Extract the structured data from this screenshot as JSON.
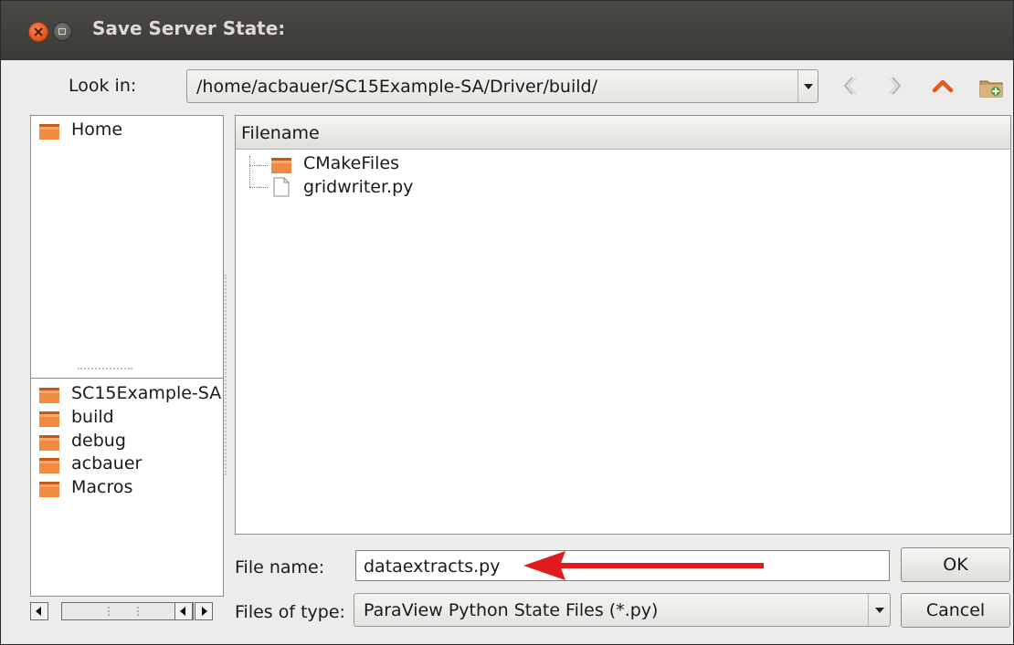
{
  "window": {
    "title": "Save Server State:"
  },
  "lookin": {
    "label": "Look in:",
    "path": "/home/acbauer/SC15Example-SA/Driver/build/"
  },
  "places_top": [
    {
      "label": "Home",
      "icon": "folder-icon"
    }
  ],
  "places_bottom": [
    {
      "label": "SC15Example-SA",
      "icon": "folder-icon"
    },
    {
      "label": "build",
      "icon": "folder-icon"
    },
    {
      "label": "debug",
      "icon": "folder-icon"
    },
    {
      "label": "acbauer",
      "icon": "folder-icon"
    },
    {
      "label": "Macros",
      "icon": "folder-icon"
    }
  ],
  "filelist": {
    "header": "Filename",
    "items": [
      {
        "name": "CMakeFiles",
        "icon": "folder-icon"
      },
      {
        "name": "gridwriter.py",
        "icon": "file-icon"
      }
    ]
  },
  "filename": {
    "label": "File name:",
    "value": "dataextracts.py"
  },
  "filetype": {
    "label": "Files of type:",
    "value": "ParaView Python State Files (*.py)"
  },
  "buttons": {
    "ok": "OK",
    "cancel": "Cancel"
  },
  "colors": {
    "folder": "#e0702c",
    "annotation_arrow": "#e01b1b",
    "titlebar": "#3c3b37"
  }
}
